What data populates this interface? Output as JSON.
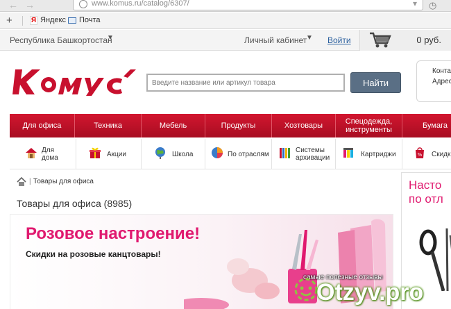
{
  "browser": {
    "back_arrow": "←",
    "forward_arrow": "→",
    "address": "www.komus.ru/catalog/6307/",
    "star_glyph": "▾",
    "shield_glyph": "◷"
  },
  "bookmarks": {
    "add_glyph": "+",
    "items": [
      {
        "label": "Яндекс",
        "icon": "yandex-icon",
        "icon_glyph": "Я"
      },
      {
        "label": "Почта",
        "icon": "mail-icon"
      }
    ]
  },
  "top_bar": {
    "region": "Республика Башкортостан",
    "region_chevron": "▼",
    "cabinet": "Личный кабинет",
    "cabinet_chevron": "▼",
    "login": "Войти",
    "cart_sum": "0 руб."
  },
  "header": {
    "search_placeholder": "Введите название или артикул товара",
    "search_button": "Найти",
    "contacts": [
      "Конта",
      "Адрес"
    ]
  },
  "categories": [
    {
      "label": "Для офиса"
    },
    {
      "label": "Техника"
    },
    {
      "label": "Мебель"
    },
    {
      "label": "Продукты"
    },
    {
      "label": "Хозтовары"
    },
    {
      "label": "Спецодежда, инструменты"
    },
    {
      "label": "Бумага"
    }
  ],
  "subcategories": [
    {
      "label": "Для дома",
      "icon": "house-icon"
    },
    {
      "label": "Акции",
      "icon": "gift-icon"
    },
    {
      "label": "Школа",
      "icon": "globe-icon"
    },
    {
      "label": "По отраслям",
      "icon": "pie-chart-icon"
    },
    {
      "label": "Системы архивации",
      "icon": "binders-icon"
    },
    {
      "label": "Картриджи",
      "icon": "cartridge-icon"
    },
    {
      "label": "Скидк",
      "icon": "discount-icon"
    }
  ],
  "breadcrumb": {
    "separator": "|",
    "current": "Товары для офиса"
  },
  "page": {
    "title": "Товары для офиса (8985)"
  },
  "banner": {
    "title": "Розовое настроение!",
    "subtitle": "Скидки на розовые канцтовары!"
  },
  "side_ad": {
    "line1": "Насто",
    "line2": "по отл"
  },
  "watermark": {
    "caption": "самые полезные отзывы",
    "text": "Otzyv.pro"
  },
  "colors": {
    "brand_red": "#c8102e",
    "banner_pink": "#e0196f",
    "search_button": "#5a6f85"
  }
}
